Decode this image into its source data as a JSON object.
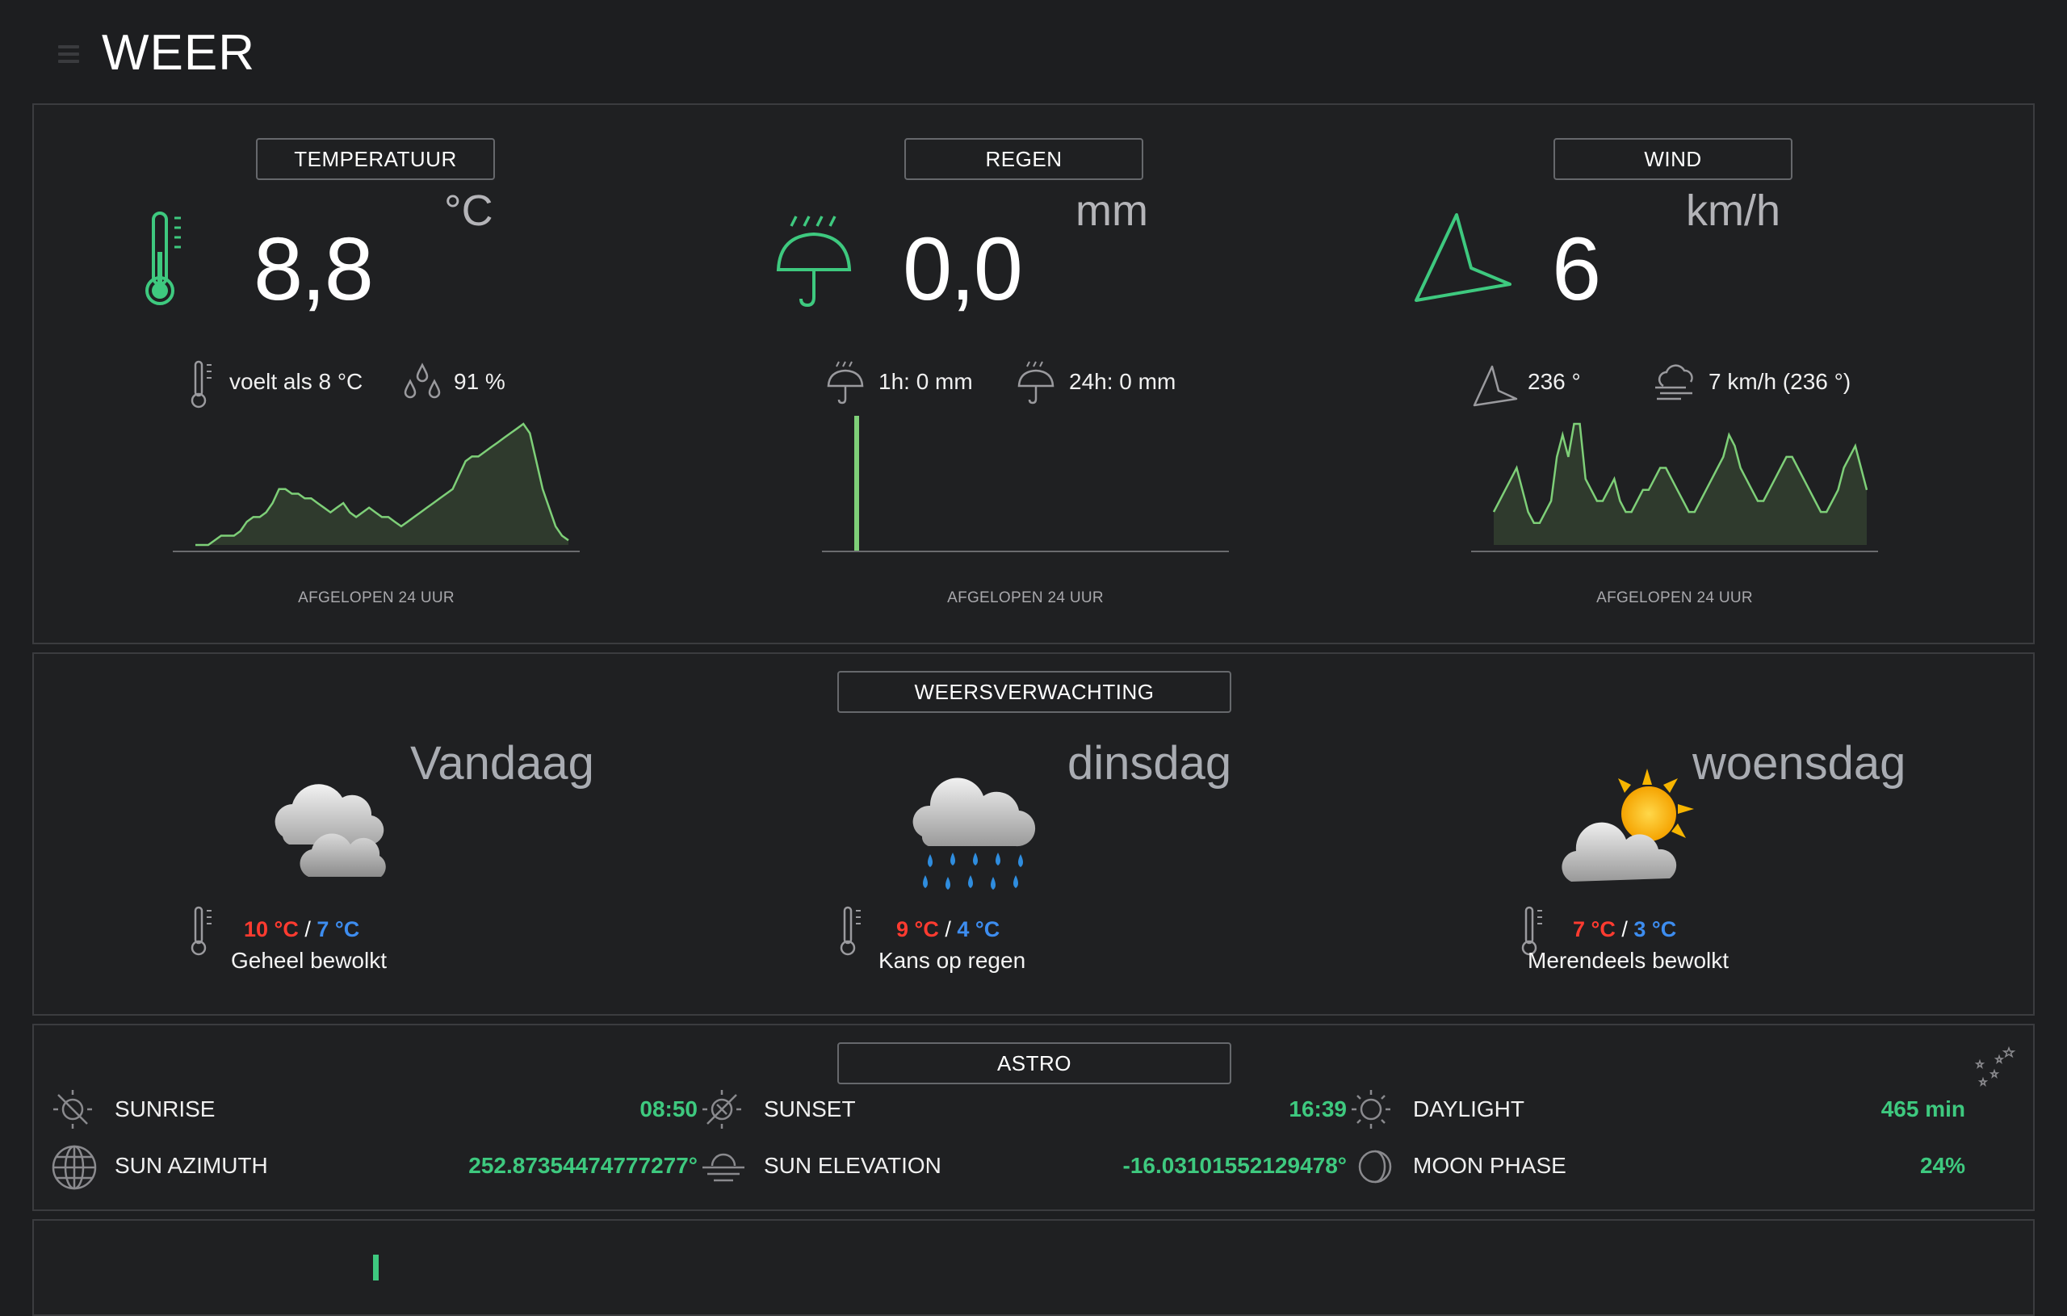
{
  "page": {
    "title": "WEER"
  },
  "colors": {
    "accent_green": "#3ec97f",
    "chart_line": "#7ecf78",
    "chart_fill": "#2f3a2d",
    "hi_temp": "#ff3b30",
    "lo_temp": "#3d8df0"
  },
  "temperature": {
    "label": "TEMPERATUUR",
    "value": "8,8",
    "unit": "°C",
    "feels_like": "voelt als 8 °C",
    "humidity": "91 %",
    "caption": "AFGELOPEN 24 UUR",
    "icon": "thermometer-icon"
  },
  "rain": {
    "label": "REGEN",
    "value": "0,0",
    "unit": "mm",
    "last_1h": "1h: 0 mm",
    "last_24h": "24h: 0 mm",
    "caption": "AFGELOPEN 24 UUR",
    "icon": "umbrella-icon"
  },
  "wind": {
    "label": "WIND",
    "value": "6",
    "unit": "km/h",
    "direction": "236 °",
    "gust": "7 km/h (236 °)",
    "caption": "AFGELOPEN 24 UUR",
    "icon": "wind-direction-icon"
  },
  "chart_data": [
    {
      "type": "area",
      "title": "",
      "xlabel": "AFGELOPEN 24 UUR",
      "values": [
        0,
        0,
        0,
        1,
        2,
        2,
        2,
        3,
        5,
        6,
        6,
        7,
        9,
        12,
        12,
        11,
        11,
        10,
        10,
        9,
        8,
        7,
        8,
        9,
        7,
        6,
        7,
        8,
        7,
        6,
        6,
        5,
        4,
        5,
        6,
        7,
        8,
        9,
        10,
        11,
        12,
        15,
        18,
        19,
        19,
        20,
        21,
        22,
        23,
        24,
        25,
        26,
        24,
        18,
        12,
        8,
        4,
        2,
        1
      ]
    },
    {
      "type": "bar",
      "title": "",
      "xlabel": "AFGELOPEN 24 UUR",
      "values": [
        1
      ]
    },
    {
      "type": "area",
      "title": "",
      "xlabel": "AFGELOPEN 24 UUR",
      "values": [
        3,
        4,
        5,
        6,
        7,
        5,
        3,
        2,
        2,
        3,
        4,
        8,
        10,
        8,
        11,
        11,
        6,
        5,
        4,
        4,
        5,
        6,
        4,
        3,
        3,
        4,
        5,
        5,
        6,
        7,
        7,
        6,
        5,
        4,
        3,
        3,
        4,
        5,
        6,
        7,
        8,
        10,
        9,
        7,
        6,
        5,
        4,
        4,
        5,
        6,
        7,
        8,
        8,
        7,
        6,
        5,
        4,
        3,
        3,
        4,
        5,
        7,
        8,
        9,
        7,
        5
      ]
    }
  ],
  "forecast": {
    "label": "WEERSVERWACHTING",
    "days": [
      {
        "name": "Vandaag",
        "hi": "10 °C",
        "lo": "7 °C",
        "condition": "Geheel bewolkt",
        "icon": "overcast-cloud-icon"
      },
      {
        "name": "dinsdag",
        "hi": "9 °C",
        "lo": "4 °C",
        "condition": "Kans op regen",
        "icon": "rain-cloud-icon"
      },
      {
        "name": "woensdag",
        "hi": "7 °C",
        "lo": "3 °C",
        "condition": "Merendeels bewolkt",
        "icon": "sun-behind-cloud-icon"
      }
    ],
    "slash": "/"
  },
  "astro": {
    "label": "ASTRO",
    "sunrise_label": "SUNRISE",
    "sunrise_value": "08:50",
    "sunset_label": "SUNSET",
    "sunset_value": "16:39",
    "daylight_label": "DAYLIGHT",
    "daylight_value": "465 min",
    "azimuth_label": "SUN AZIMUTH",
    "azimuth_value": "252.87354474777277°",
    "elevation_label": "SUN ELEVATION",
    "elevation_value": "-16.03101552129478°",
    "moon_label": "MOON PHASE",
    "moon_value": "24%"
  }
}
